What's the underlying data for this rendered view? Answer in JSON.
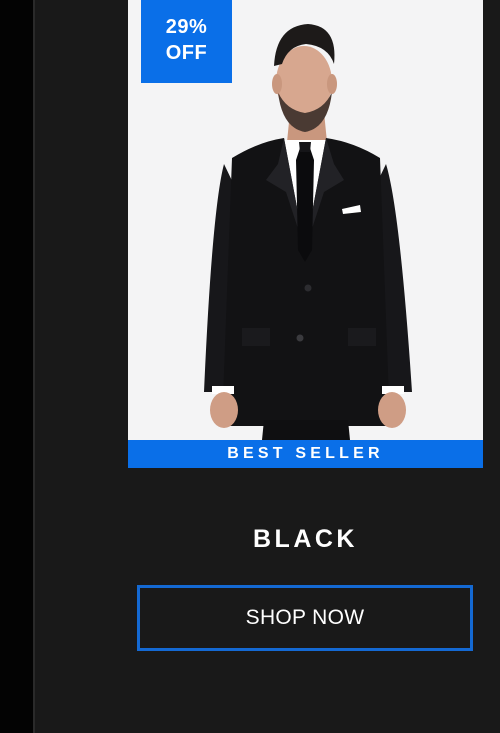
{
  "product": {
    "badge": {
      "percent": "29%",
      "suffix": "OFF"
    },
    "ribbon_label": "BEST SELLER",
    "color_name": "BLACK",
    "cta_label": "SHOP NOW",
    "image_subject": "man-in-black-suit"
  },
  "colors": {
    "accent": "#0a6fe8",
    "button_border": "#1469d3",
    "page_background": "#191919",
    "card_background": "#f4f4f5",
    "rail": "#030303",
    "text": "#ffffff"
  }
}
